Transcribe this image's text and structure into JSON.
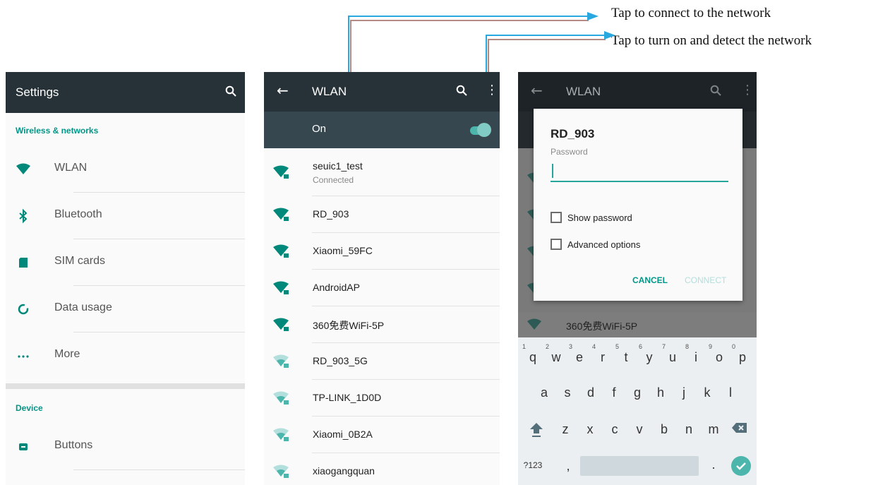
{
  "annotations": {
    "connect": "Tap to connect to the network",
    "turn_on": "Tap to turn on and detect the network"
  },
  "colors": {
    "accent": "#009688",
    "toolbar": "#263238",
    "arrow_blue": "#29a8e0",
    "arrow_shadow": "#b48a84"
  },
  "settings": {
    "title": "Settings",
    "search_icon": "search-icon",
    "sections": [
      {
        "label": "Wireless & networks"
      },
      {
        "label": "Device"
      }
    ],
    "items": [
      {
        "label": "WLAN",
        "icon": "wifi-icon"
      },
      {
        "label": "Bluetooth",
        "icon": "bluetooth-icon"
      },
      {
        "label": "SIM cards",
        "icon": "sim-card-icon"
      },
      {
        "label": "Data usage",
        "icon": "data-usage-icon"
      },
      {
        "label": "More",
        "icon": "more-icon"
      },
      {
        "label": "Buttons",
        "icon": "buttons-icon"
      }
    ]
  },
  "wlan": {
    "title": "WLAN",
    "back_icon": "back-arrow-icon",
    "on_label": "On",
    "switch_on": true,
    "networks": [
      {
        "name": "seuic1_test",
        "status": "Connected",
        "signal": "full"
      },
      {
        "name": "RD_903",
        "status": "",
        "signal": "full"
      },
      {
        "name": "Xiaomi_59FC",
        "status": "",
        "signal": "full"
      },
      {
        "name": "AndroidAP",
        "status": "",
        "signal": "full"
      },
      {
        "name": "360免费WiFi-5P",
        "status": "",
        "signal": "full"
      },
      {
        "name": "RD_903_5G",
        "status": "",
        "signal": "medium"
      },
      {
        "name": "TP-LINK_1D0D",
        "status": "",
        "signal": "medium"
      },
      {
        "name": "Xiaomi_0B2A",
        "status": "",
        "signal": "medium"
      },
      {
        "name": "xiaogangquan",
        "status": "",
        "signal": "medium"
      }
    ]
  },
  "dialog": {
    "bg_title": "WLAN",
    "bg_network": "360免费WiFi-5P",
    "title": "RD_903",
    "password_label": "Password",
    "password_value": "",
    "show_password": "Show password",
    "advanced_options": "Advanced options",
    "cancel": "CANCEL",
    "connect": "CONNECT"
  },
  "keyboard": {
    "row1": [
      "q",
      "w",
      "e",
      "r",
      "t",
      "y",
      "u",
      "i",
      "o",
      "p"
    ],
    "row1_hints": [
      "1",
      "2",
      "3",
      "4",
      "5",
      "6",
      "7",
      "8",
      "9",
      "0"
    ],
    "row2": [
      "a",
      "s",
      "d",
      "f",
      "g",
      "h",
      "j",
      "k",
      "l"
    ],
    "row3": [
      "z",
      "x",
      "c",
      "v",
      "b",
      "n",
      "m"
    ],
    "sym_key": "?123",
    "comma": ",",
    "period": "."
  }
}
